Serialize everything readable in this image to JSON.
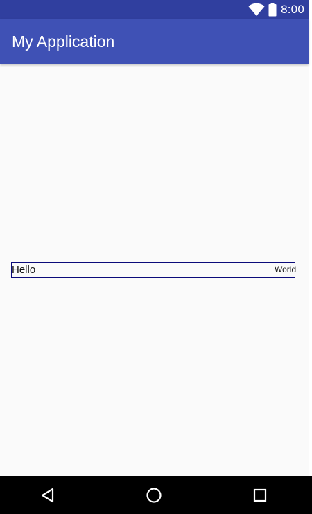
{
  "status_bar": {
    "time": "8:00",
    "icons": [
      "wifi-icon",
      "battery-icon"
    ],
    "background": "#303f9f"
  },
  "app_bar": {
    "title": "My Application",
    "background": "#3f51b5"
  },
  "content": {
    "left_text": "Hello",
    "right_text": "World",
    "border_color": "#0b0b7a"
  },
  "nav_bar": {
    "buttons": [
      "back-icon",
      "home-icon",
      "recents-icon"
    ],
    "background": "#000000"
  }
}
